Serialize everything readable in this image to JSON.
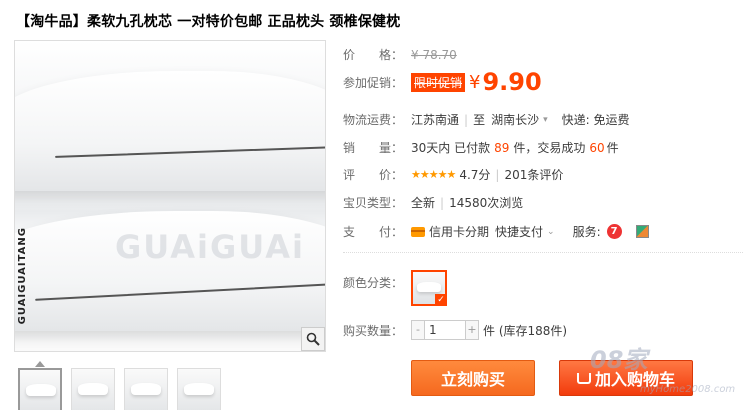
{
  "product": {
    "title": "【淘牛品】柔软九孔枕芯 一对特价包邮 正品枕头 颈椎保健枕"
  },
  "gallery": {
    "watermark": "GUAiGUAi",
    "vertical_brand": "GUAIGUAITANG",
    "zoom_icon": "magnifier-icon",
    "thumbnail_count": 4
  },
  "price": {
    "label": "价　　格：",
    "original": "¥ 78.70",
    "promo_label": "参加促销：",
    "promo_tag": "限时促销",
    "currency": "¥",
    "promo_value": "9.90"
  },
  "shipping": {
    "label": "物流运费：",
    "from": "江苏南通",
    "to_prefix": "至",
    "to": "湖南长沙",
    "express": "快递: 免运费"
  },
  "sales": {
    "label": "销　　量：",
    "prefix": "30天内 已付款",
    "paid_count": "89",
    "mid": "件，交易成功",
    "success_count": "60",
    "suffix": "件"
  },
  "rating": {
    "label": "评　　价：",
    "stars": "★★★★★",
    "score": "4.7分",
    "review_count": "201条评价"
  },
  "item_type": {
    "label": "宝贝类型：",
    "condition": "全新",
    "views": "14580次浏览"
  },
  "payment": {
    "label": "支　　付：",
    "credit": "信用卡分期",
    "quick": "快捷支付",
    "service_label": "服务:",
    "service_badge": "7"
  },
  "color": {
    "label": "颜色分类："
  },
  "quantity": {
    "label": "购买数量：",
    "minus": "-",
    "value": "1",
    "plus": "+",
    "stock": "件 (库存188件)"
  },
  "buttons": {
    "buy": "立刻购买",
    "cart": "加入购物车"
  },
  "site_watermark": {
    "main": "08家",
    "sub": "myHome2008.com"
  },
  "colors": {
    "accent": "#ff4400",
    "button_orange": "#f5691f"
  }
}
